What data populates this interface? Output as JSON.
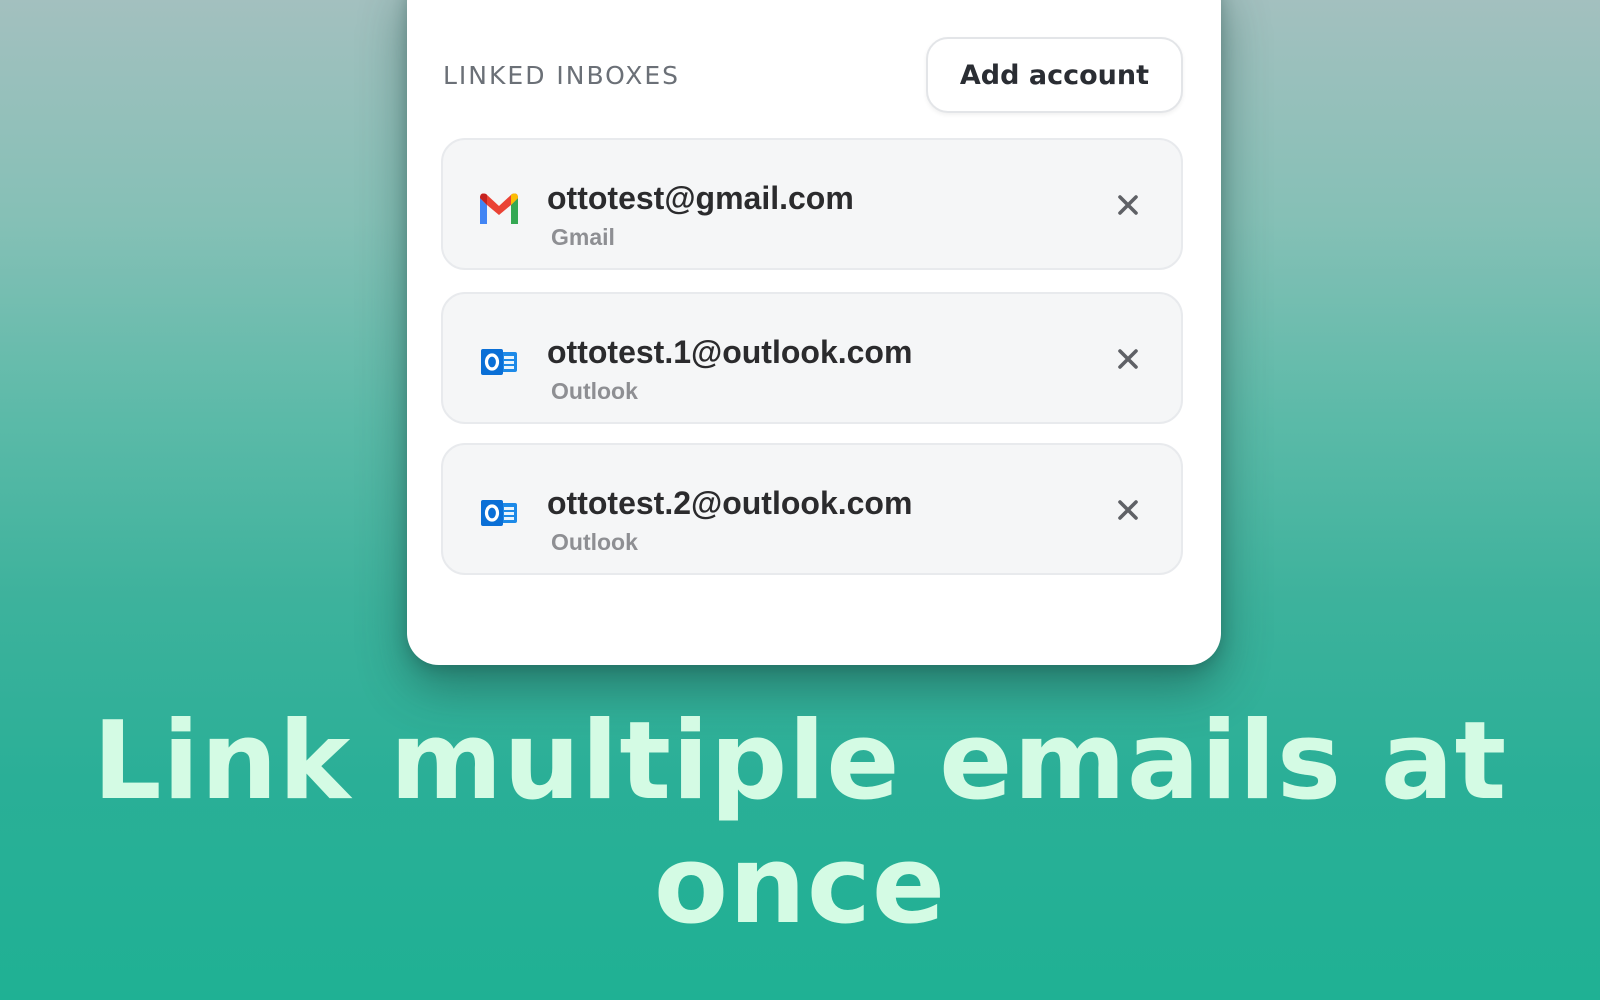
{
  "header": {
    "section_label": "LINKED INBOXES",
    "add_account_label": "Add account"
  },
  "accounts": [
    {
      "email": "ottotest@gmail.com",
      "provider": "Gmail",
      "icon": "gmail-icon"
    },
    {
      "email": "ottotest.1@outlook.com",
      "provider": "Outlook",
      "icon": "outlook-icon"
    },
    {
      "email": "ottotest.2@outlook.com",
      "provider": "Outlook",
      "icon": "outlook-icon"
    }
  ],
  "caption": {
    "line1": "Link multiple emails at",
    "line2": "once"
  },
  "colors": {
    "caption": "#d4fbe4",
    "gmail_red": "#ea4335",
    "gmail_blue": "#4285f4",
    "gmail_green": "#34a853",
    "gmail_yellow": "#fbbc04",
    "outlook_blue": "#0a6fd6"
  }
}
